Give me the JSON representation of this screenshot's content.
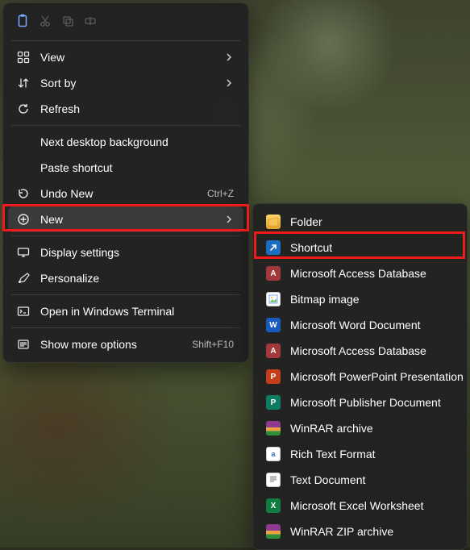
{
  "context_menu": {
    "items": {
      "view": {
        "label": "View"
      },
      "sortby": {
        "label": "Sort by"
      },
      "refresh": {
        "label": "Refresh"
      },
      "nextbg": {
        "label": "Next desktop background"
      },
      "pastesc": {
        "label": "Paste shortcut"
      },
      "undo": {
        "label": "Undo New",
        "accel": "Ctrl+Z"
      },
      "new": {
        "label": "New"
      },
      "display": {
        "label": "Display settings"
      },
      "personalize": {
        "label": "Personalize"
      },
      "terminal": {
        "label": "Open in Windows Terminal"
      },
      "more": {
        "label": "Show more options",
        "accel": "Shift+F10"
      }
    }
  },
  "submenu_new": {
    "folder": {
      "label": "Folder"
    },
    "shortcut": {
      "label": "Shortcut"
    },
    "access1": {
      "label": "Microsoft Access Database"
    },
    "bitmap": {
      "label": "Bitmap image"
    },
    "word": {
      "label": "Microsoft Word Document"
    },
    "access2": {
      "label": "Microsoft Access Database"
    },
    "ppt": {
      "label": "Microsoft PowerPoint Presentation"
    },
    "publisher": {
      "label": "Microsoft Publisher Document"
    },
    "rar": {
      "label": "WinRAR archive"
    },
    "rtf": {
      "label": "Rich Text Format"
    },
    "txt": {
      "label": "Text Document"
    },
    "excel": {
      "label": "Microsoft Excel Worksheet"
    },
    "zip": {
      "label": "WinRAR ZIP archive"
    }
  }
}
